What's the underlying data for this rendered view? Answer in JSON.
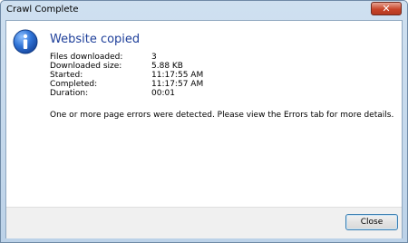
{
  "window": {
    "title": "Crawl Complete",
    "close_glyph": "✕"
  },
  "dialog": {
    "icon": "info-icon",
    "heading": "Website copied",
    "details": [
      {
        "label": "Files downloaded:",
        "value": "3"
      },
      {
        "label": "Downloaded size:",
        "value": "5.88 KB"
      },
      {
        "label": "Started:",
        "value": "11:17:55 AM"
      },
      {
        "label": "Completed:",
        "value": "11:17:57 AM"
      },
      {
        "label": "Duration:",
        "value": "00:01"
      }
    ],
    "message": "One or more page errors were detected. Please view the Errors tab for more details."
  },
  "buttons": {
    "close_label": "Close"
  },
  "colors": {
    "heading": "#1e3f9a",
    "icon_blue": "#1f5fbf",
    "close_red": "#c8452a"
  }
}
